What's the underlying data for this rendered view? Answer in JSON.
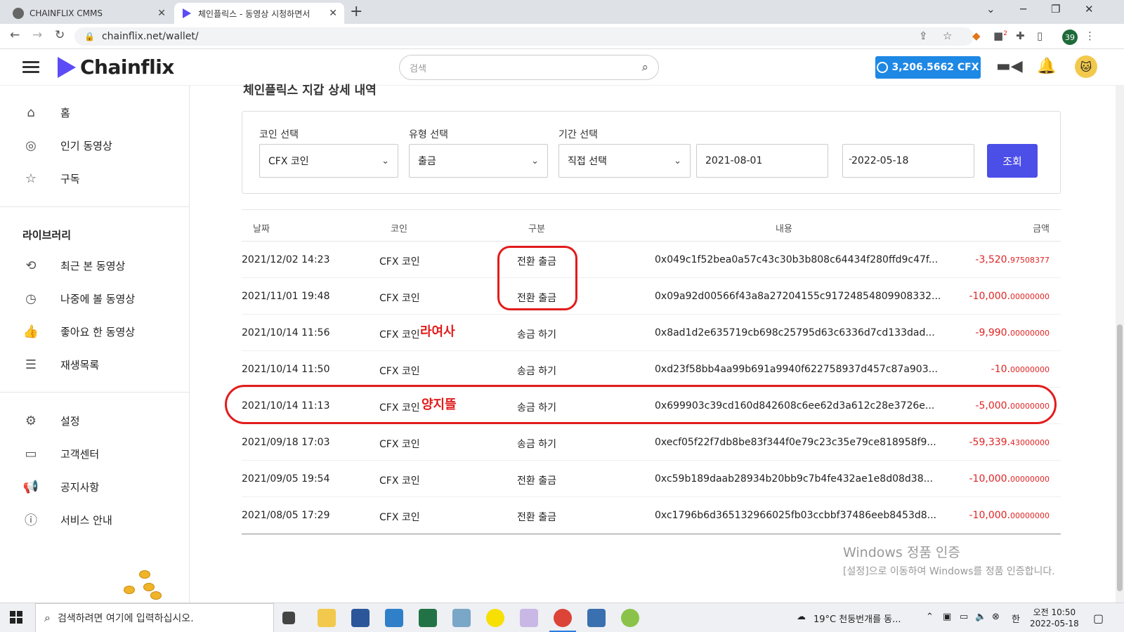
{
  "browser": {
    "tabs": [
      {
        "title": "CHAINFLIX CMMS",
        "active": false
      },
      {
        "title": "체인플릭스 - 동영상 시청하면서",
        "active": true
      }
    ],
    "url": "chainflix.net/wallet/",
    "profile_badge": "39",
    "ext_badge": "2"
  },
  "header": {
    "logo": "Chainflix",
    "search_placeholder": "검색",
    "balance": "3,206.5662 CFX"
  },
  "sidebar": {
    "main_items": [
      {
        "label": "홈",
        "icon": "home-icon"
      },
      {
        "label": "인기 동영상",
        "icon": "popular-icon"
      },
      {
        "label": "구독",
        "icon": "subscriptions-icon"
      }
    ],
    "library_title": "라이브러리",
    "library_items": [
      {
        "label": "최근 본 동영상",
        "icon": "history-icon"
      },
      {
        "label": "나중에 볼 동영상",
        "icon": "clock-icon"
      },
      {
        "label": "좋아요 한 동영상",
        "icon": "thumbs-up-icon"
      },
      {
        "label": "재생목록",
        "icon": "playlist-icon"
      }
    ],
    "support_items": [
      {
        "label": "설정",
        "icon": "gear-icon"
      },
      {
        "label": "고객센터",
        "icon": "help-icon"
      },
      {
        "label": "공지사항",
        "icon": "megaphone-icon"
      },
      {
        "label": "서비스 안내",
        "icon": "info-icon"
      }
    ]
  },
  "main": {
    "page_title": "체인플릭스 지갑 상세 내역",
    "filters": {
      "coin_label": "코인 선택",
      "coin_value": "CFX 코인",
      "type_label": "유형 선택",
      "type_value": "출금",
      "period_label": "기간 선택",
      "period_value": "직접 선택",
      "date_from": "2021-08-01",
      "date_sep": "-",
      "date_to": "2022-05-18",
      "query_button": "조회"
    },
    "columns": [
      "날짜",
      "코인",
      "구분",
      "내용",
      "금액"
    ],
    "rows": [
      {
        "date": "2021/12/02 14:23",
        "coin": "CFX 코인",
        "type": "전환 출금",
        "content": "0x049c1f52bea0a57c43c30b3b808c64434f280ffd9c47f...",
        "amount_int": "-3,520.",
        "amount_dec": "97508377"
      },
      {
        "date": "2021/11/01 19:48",
        "coin": "CFX 코인",
        "type": "전환 출금",
        "content": "0x09a92d00566f43a8a27204155c91724854809908332...",
        "amount_int": "-10,000.",
        "amount_dec": "00000000"
      },
      {
        "date": "2021/10/14 11:56",
        "coin": "CFX 코인",
        "type": "송금 하기",
        "content": "0x8ad1d2e635719cb698c25795d63c6336d7cd133dad...",
        "amount_int": "-9,990.",
        "amount_dec": "00000000"
      },
      {
        "date": "2021/10/14 11:50",
        "coin": "CFX 코인",
        "type": "송금 하기",
        "content": "0xd23f58bb4aa99b691a9940f622758937d457c87a903...",
        "amount_int": "-10.",
        "amount_dec": "00000000"
      },
      {
        "date": "2021/10/14 11:13",
        "coin": "CFX 코인",
        "type": "송금 하기",
        "content": "0x699903c39cd160d842608c6ee62d3a612c28e3726e...",
        "amount_int": "-5,000.",
        "amount_dec": "00000000"
      },
      {
        "date": "2021/09/18 17:03",
        "coin": "CFX 코인",
        "type": "송금 하기",
        "content": "0xecf05f22f7db8be83f344f0e79c23c35e79ce818958f9...",
        "amount_int": "-59,339.",
        "amount_dec": "43000000"
      },
      {
        "date": "2021/09/05 19:54",
        "coin": "CFX 코인",
        "type": "전환 출금",
        "content": "0xc59b189daab28934b20bb9c7b4fe432ae1e8d08d38...",
        "amount_int": "-10,000.",
        "amount_dec": "00000000"
      },
      {
        "date": "2021/08/05 17:29",
        "coin": "CFX 코인",
        "type": "전환 출금",
        "content": "0xc1796b6d365132966025fb03ccbbf37486eeb8453d8...",
        "amount_int": "-10,000.",
        "amount_dec": "00000000"
      }
    ],
    "annotations": {
      "row3": "라여사",
      "row5": "양지뜰"
    }
  },
  "watermark": {
    "line1": "Windows 정품 인증",
    "line2": "[설정]으로 이동하여 Windows를 정품 인증합니다."
  },
  "taskbar": {
    "search_placeholder": "검색하려면 여기에 입력하십시오.",
    "weather": "19°C  천둥번개를 동...",
    "ime": "한",
    "time": "오전 10:50",
    "date": "2022-05-18"
  },
  "colors": {
    "accent": "#4c4ee8",
    "balance": "#1e88e5",
    "amount": "#e02424",
    "annotation": "#e21c1c"
  }
}
